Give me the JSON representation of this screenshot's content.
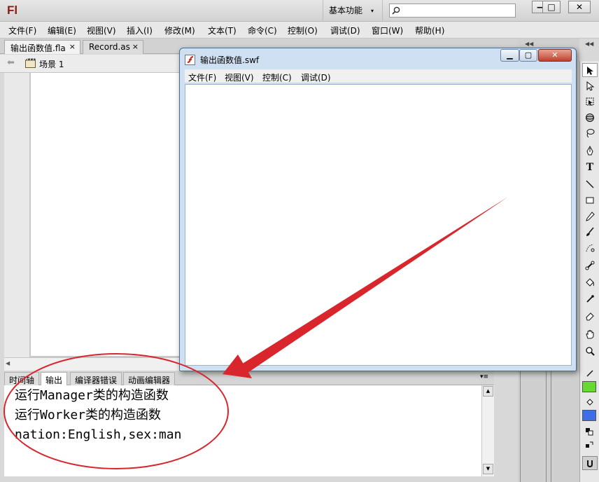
{
  "app": {
    "logo": "Fl",
    "workspace_label": "基本功能",
    "workspace_arrow": "▾",
    "window_controls": {
      "minimize": "—",
      "maximize": "□",
      "close": "✕"
    }
  },
  "menu": {
    "items": [
      {
        "label": "文件(F)"
      },
      {
        "label": "编辑(E)"
      },
      {
        "label": "视图(V)"
      },
      {
        "label": "插入(I)"
      },
      {
        "label": "修改(M)"
      },
      {
        "label": "文本(T)"
      },
      {
        "label": "命令(C)"
      },
      {
        "label": "控制(O)"
      },
      {
        "label": "调试(D)"
      },
      {
        "label": "窗口(W)"
      },
      {
        "label": "帮助(H)"
      }
    ]
  },
  "document_tabs": [
    {
      "label": "输出函数值.fla",
      "close": "×"
    },
    {
      "label": "Record.as",
      "close": "×"
    }
  ],
  "editbar": {
    "scene_label": "场景 1"
  },
  "panel": {
    "tabs": [
      {
        "label": "时间轴"
      },
      {
        "label": "输出"
      },
      {
        "label": "编译器错误"
      },
      {
        "label": "动画编辑器"
      }
    ],
    "menu_glyph": "▾≡",
    "output_lines": [
      "运行Manager类的构造函数",
      "运行Worker类的构造函数",
      "nation:English,sex:man"
    ]
  },
  "swf_window": {
    "title": "输出函数值.swf",
    "menu": [
      {
        "label": "文件(F)"
      },
      {
        "label": "视图(V)"
      },
      {
        "label": "控制(C)"
      },
      {
        "label": "调试(D)"
      }
    ],
    "controls": {
      "minimize": "▁",
      "maximize": "▢",
      "close": "✕"
    }
  },
  "tools": [
    {
      "icon": "selection-arrow-icon"
    },
    {
      "icon": "subselection-arrow-icon"
    },
    {
      "icon": "free-transform-icon"
    },
    {
      "icon": "3d-rotation-icon"
    },
    {
      "icon": "lasso-icon"
    },
    {
      "icon": "pen-icon"
    },
    {
      "icon": "text-icon",
      "glyph": "T"
    },
    {
      "icon": "line-icon"
    },
    {
      "icon": "rectangle-icon"
    },
    {
      "icon": "pencil-icon"
    },
    {
      "icon": "brush-icon"
    },
    {
      "icon": "deco-icon"
    },
    {
      "icon": "bone-icon"
    },
    {
      "icon": "paint-bucket-icon"
    },
    {
      "icon": "eyedropper-icon"
    },
    {
      "icon": "eraser-icon"
    },
    {
      "icon": "hand-icon"
    },
    {
      "icon": "zoom-icon"
    }
  ],
  "colors": {
    "stroke": "#66d92e",
    "fill": "#3d6ee8",
    "annotation": "#d8262c",
    "logo": "#8a1a12"
  }
}
